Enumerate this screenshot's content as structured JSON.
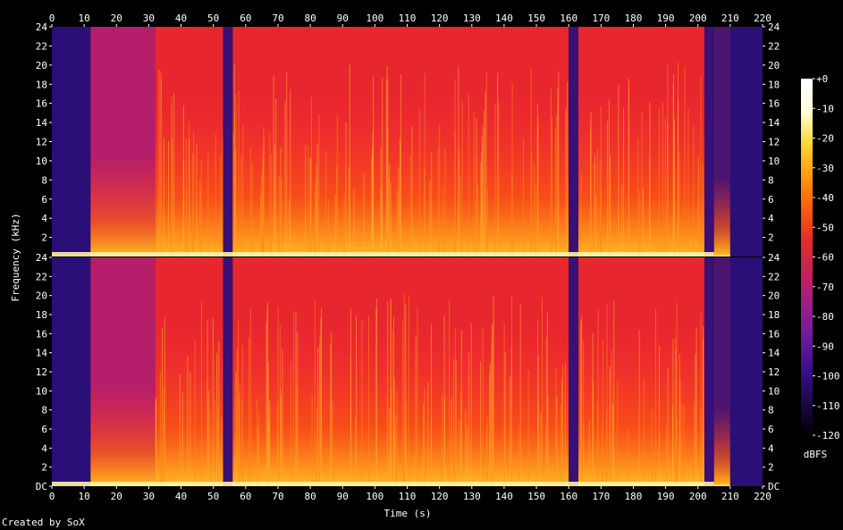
{
  "chart_data": {
    "type": "heatmap",
    "subtype": "spectrogram",
    "xlabel": "Time (s)",
    "ylabel": "Frequency (kHz)",
    "xlim": [
      0,
      220
    ],
    "ylim": [
      0,
      24
    ],
    "x_ticks": [
      0,
      10,
      20,
      30,
      40,
      50,
      60,
      70,
      80,
      90,
      100,
      110,
      120,
      130,
      140,
      150,
      160,
      170,
      180,
      190,
      200,
      210,
      220
    ],
    "y_ticks": [
      "DC",
      "2",
      "4",
      "6",
      "8",
      "10",
      "12",
      "14",
      "16",
      "18",
      "20",
      "22",
      "24"
    ],
    "channels": 2,
    "colorbar": {
      "unit": "dBFS",
      "range": [
        -120,
        0
      ],
      "ticks": [
        "+0",
        "-10",
        "-20",
        "-30",
        "-40",
        "-50",
        "-60",
        "-70",
        "-80",
        "-90",
        "-100",
        "-110",
        "-120"
      ],
      "colors": [
        "#000000",
        "#1a0844",
        "#3a0f8a",
        "#6a1a9a",
        "#9a1f8a",
        "#c8205a",
        "#e82a2a",
        "#ff5a10",
        "#ff9a08",
        "#ffd830",
        "#ffffe0",
        "#ffffff"
      ]
    },
    "segments": [
      {
        "start": 0,
        "end": 12,
        "level": "quiet"
      },
      {
        "start": 12,
        "end": 32,
        "level": "medium"
      },
      {
        "start": 32,
        "end": 53,
        "level": "loud"
      },
      {
        "start": 53,
        "end": 56,
        "level": "gap"
      },
      {
        "start": 56,
        "end": 160,
        "level": "loud"
      },
      {
        "start": 160,
        "end": 163,
        "level": "gap"
      },
      {
        "start": 163,
        "end": 202,
        "level": "loud"
      },
      {
        "start": 202,
        "end": 205,
        "level": "gap"
      },
      {
        "start": 205,
        "end": 210,
        "level": "fade"
      },
      {
        "start": 210,
        "end": 220,
        "level": "quiet"
      }
    ]
  },
  "credit": "Created by SoX"
}
